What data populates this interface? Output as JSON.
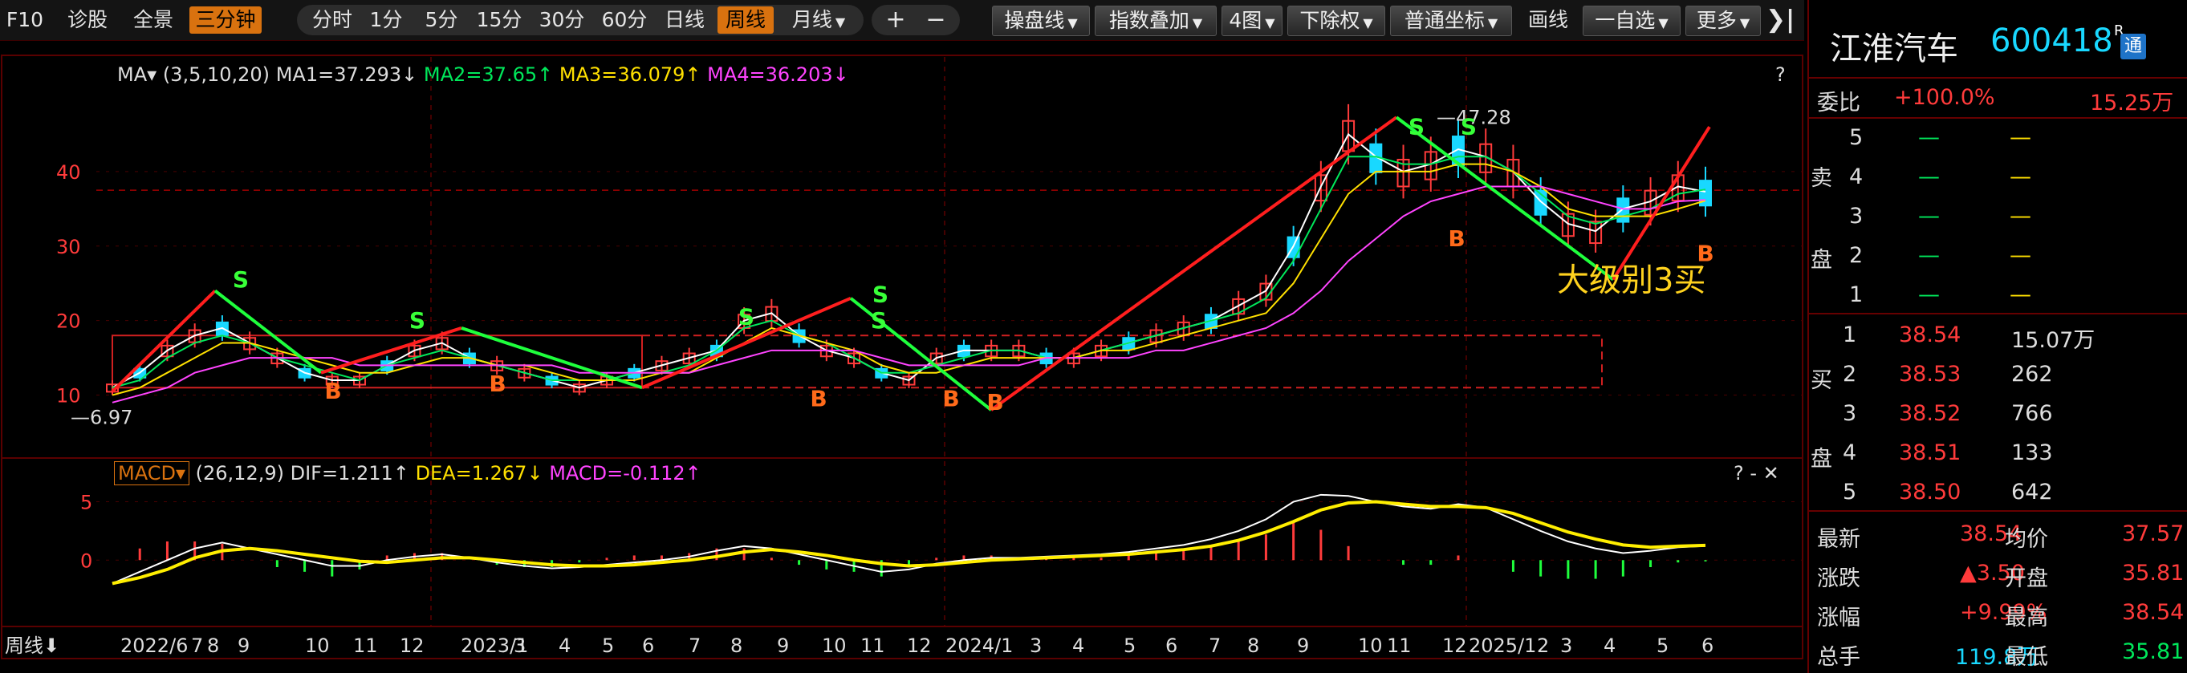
{
  "toolbar": {
    "left_items": [
      "F10",
      "诊股",
      "全景",
      "三分钟"
    ],
    "period_items": [
      "分时",
      "1分",
      "5分",
      "15分",
      "30分",
      "60分",
      "日线",
      "周线",
      "月线"
    ],
    "active_period": "周线",
    "plus": "+",
    "minus": "−",
    "right_buttons": [
      "操盘线",
      "指数叠加",
      "4图",
      "下除权",
      "普通坐标",
      "画线",
      "一自选",
      "更多"
    ],
    "collapse_icon": "chevron-right-bar-icon"
  },
  "ma_legend": {
    "label": "MA",
    "params": "(3,5,10,20)",
    "ma1": "MA1=37.293↓",
    "ma2": "MA2=37.65↑",
    "ma3": "MA3=36.079↑",
    "ma4": "MA4=36.203↓",
    "help": "?"
  },
  "macd_legend": {
    "label": "MACD",
    "params": "(26,12,9)",
    "dif": "DIF=1.211↑",
    "dea": "DEA=1.267↓",
    "macd": "MACD=-0.112↑",
    "controls": "? -  ✕"
  },
  "colors": {
    "accent": "#d9720f",
    "up": "#ff3b3b",
    "down": "#19d8ff",
    "ma1": "#ffffff",
    "ma2": "#00e85b",
    "ma3": "#ffe000",
    "ma4": "#ff44ff"
  },
  "chart_data": {
    "type": "line",
    "title": "",
    "price_axis": {
      "ticks": [
        40,
        30,
        20,
        10
      ],
      "ylim": [
        5,
        50
      ]
    },
    "macd_axis": {
      "ticks": [
        5,
        0
      ],
      "ylim": [
        -5,
        6
      ]
    },
    "time_labels": [
      "2022/6",
      "7",
      "8",
      "9",
      "10",
      "11",
      "12",
      "2023/1",
      "3",
      "4",
      "5",
      "6",
      "7",
      "8",
      "9",
      "10",
      "11",
      "12",
      "2024/1",
      "3",
      "4",
      "5",
      "6",
      "7",
      "8",
      "9",
      "10",
      "11",
      "12",
      "2025/1",
      "2",
      "3",
      "4",
      "5",
      "6"
    ],
    "period_label": "周线",
    "high_marker": 47.28,
    "low_marker": 6.97,
    "annotation": "大级别3买",
    "signals": [
      {
        "label": "S",
        "price": 24.5
      },
      {
        "label": "B",
        "price": 9.5
      },
      {
        "label": "S",
        "price": 19
      },
      {
        "label": "B",
        "price": 10.5
      },
      {
        "label": "S",
        "price": 19.5
      },
      {
        "label": "B",
        "price": 8.5
      },
      {
        "label": "S",
        "price": 19
      },
      {
        "label": "B",
        "price": 8.5
      },
      {
        "label": "S",
        "price": 22.5
      },
      {
        "label": "B",
        "price": 8
      },
      {
        "label": "S",
        "price": 45
      },
      {
        "label": "S",
        "price": 45
      },
      {
        "label": "B",
        "price": 30
      },
      {
        "label": "B",
        "price": 28
      }
    ],
    "series": [
      {
        "name": "MA1",
        "values": [
          11,
          13,
          16,
          18,
          19,
          17,
          15,
          13,
          12,
          12,
          14,
          16,
          17,
          15,
          14,
          13,
          12,
          11,
          12,
          13,
          14,
          15,
          16,
          20,
          21,
          18,
          16,
          15,
          13,
          12,
          15,
          16,
          16,
          16,
          15,
          15,
          16,
          17,
          18,
          19,
          20,
          22,
          24,
          30,
          38,
          45,
          42,
          40,
          41,
          43,
          42,
          40,
          36,
          33,
          32,
          35,
          36,
          38,
          37.3
        ]
      },
      {
        "name": "MA2",
        "values": [
          11,
          12,
          15,
          17,
          18,
          17,
          15,
          14,
          13,
          12,
          14,
          15,
          16,
          15,
          14,
          13,
          12,
          12,
          12,
          13,
          13,
          14,
          16,
          19,
          20,
          18,
          17,
          15,
          13,
          13,
          14,
          15,
          16,
          16,
          15,
          15,
          16,
          17,
          18,
          19,
          20,
          21,
          23,
          28,
          35,
          42,
          42,
          41,
          41,
          42,
          42,
          40,
          37,
          34,
          33,
          34,
          35,
          37,
          37.6
        ]
      },
      {
        "name": "MA3",
        "values": [
          10,
          11,
          13,
          15,
          17,
          17,
          16,
          15,
          14,
          13,
          13,
          14,
          15,
          15,
          14,
          14,
          13,
          12,
          12,
          12,
          13,
          13,
          15,
          17,
          19,
          18,
          17,
          16,
          14,
          13,
          13,
          14,
          15,
          15,
          15,
          15,
          16,
          16,
          17,
          18,
          19,
          20,
          21,
          25,
          31,
          37,
          40,
          40,
          40,
          41,
          41,
          40,
          38,
          35,
          34,
          34,
          34,
          35,
          36.1
        ]
      },
      {
        "name": "MA4",
        "values": [
          9,
          10,
          11,
          13,
          14,
          15,
          15,
          15,
          15,
          14,
          14,
          14,
          14,
          14,
          14,
          14,
          14,
          13,
          13,
          13,
          13,
          13,
          14,
          15,
          16,
          16,
          16,
          16,
          15,
          14,
          14,
          14,
          14,
          14,
          15,
          15,
          15,
          15,
          16,
          16,
          17,
          18,
          19,
          21,
          24,
          28,
          31,
          34,
          36,
          37,
          38,
          38,
          38,
          37,
          36,
          35,
          35,
          36,
          36.2
        ]
      }
    ],
    "macd_series": [
      {
        "name": "DIF",
        "values": [
          -2,
          -1,
          0,
          1,
          1.5,
          1,
          0.5,
          0,
          -0.5,
          -0.5,
          0,
          0.3,
          0.5,
          0.2,
          -0.2,
          -0.5,
          -0.7,
          -0.6,
          -0.4,
          -0.2,
          0,
          0.3,
          0.8,
          1.2,
          1,
          0.5,
          0,
          -0.5,
          -1,
          -0.8,
          -0.3,
          0,
          0.2,
          0.2,
          0.3,
          0.4,
          0.5,
          0.7,
          1,
          1.3,
          1.8,
          2.5,
          3.5,
          5,
          5.6,
          5.5,
          5,
          4.6,
          4.4,
          4.8,
          4.5,
          3.5,
          2.5,
          1.6,
          1,
          0.6,
          0.8,
          1.1,
          1.211
        ]
      },
      {
        "name": "DEA",
        "values": [
          -2,
          -1.5,
          -0.8,
          0.2,
          0.8,
          1,
          0.8,
          0.5,
          0.2,
          -0.1,
          -0.2,
          0,
          0.2,
          0.2,
          0,
          -0.2,
          -0.4,
          -0.5,
          -0.5,
          -0.4,
          -0.2,
          0,
          0.3,
          0.7,
          0.9,
          0.7,
          0.4,
          0,
          -0.3,
          -0.5,
          -0.4,
          -0.2,
          0,
          0.1,
          0.2,
          0.3,
          0.4,
          0.5,
          0.7,
          0.9,
          1.2,
          1.7,
          2.4,
          3.3,
          4.3,
          4.9,
          5,
          4.8,
          4.6,
          4.6,
          4.5,
          4,
          3.2,
          2.4,
          1.8,
          1.3,
          1.1,
          1.2,
          1.267
        ]
      }
    ]
  },
  "right_panel": {
    "stock_name": "江淮汽车",
    "stock_code": "600418",
    "badge_r": "R",
    "badge_tong": "通",
    "webi_label": "委比",
    "webi_value": "+100.0%",
    "webi_diff": "15.25万",
    "sell_label_1": "卖",
    "sell_label_2": "盘",
    "buy_label_1": "买",
    "buy_label_2": "盘",
    "sell_rows": [
      {
        "level": "5",
        "price": "—",
        "vol": "—"
      },
      {
        "level": "4",
        "price": "—",
        "vol": "—"
      },
      {
        "level": "3",
        "price": "—",
        "vol": "—"
      },
      {
        "level": "2",
        "price": "—",
        "vol": "—"
      },
      {
        "level": "1",
        "price": "—",
        "vol": "—"
      }
    ],
    "buy_rows": [
      {
        "level": "1",
        "price": "38.54",
        "vol": "15.07万"
      },
      {
        "level": "2",
        "price": "38.53",
        "vol": "262"
      },
      {
        "level": "3",
        "price": "38.52",
        "vol": "766"
      },
      {
        "level": "4",
        "price": "38.51",
        "vol": "133"
      },
      {
        "level": "5",
        "price": "38.50",
        "vol": "642"
      }
    ],
    "stats": [
      {
        "l1": "最新",
        "v1": "38.54",
        "l2": "均价",
        "v2": "37.57"
      },
      {
        "l1": "涨跌",
        "v1": "▲3.50",
        "l2": "开盘",
        "v2": "35.81"
      },
      {
        "l1": "涨幅",
        "v1": "+9.99%",
        "l2": "最高",
        "v2": "38.54"
      },
      {
        "l1": "总手",
        "v1": "119.8万",
        "l2": "最低",
        "v2": "35.81"
      }
    ]
  }
}
